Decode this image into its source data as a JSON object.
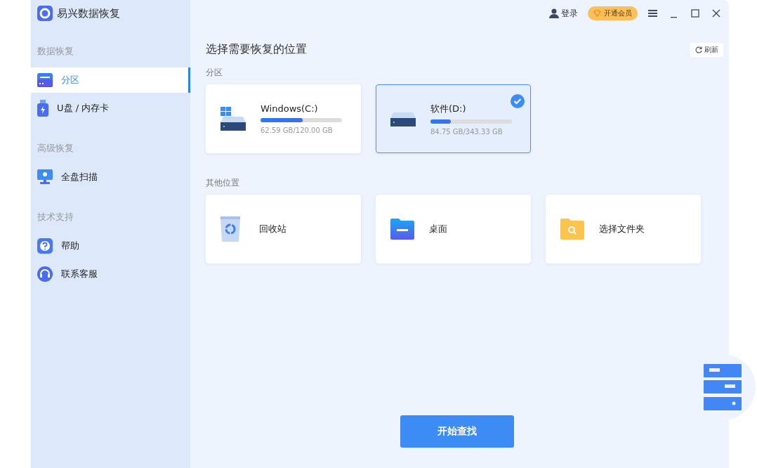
{
  "app": {
    "title": "易兴数据恢复"
  },
  "sidebar": [
    {
      "heading": "数据恢复",
      "items": [
        {
          "label": "分区",
          "kind": "drive",
          "selected": true
        },
        {
          "label": "U盘 / 内存卡",
          "kind": "usb",
          "selected": false
        }
      ]
    },
    {
      "heading": "高级恢复",
      "items": [
        {
          "label": "全盘扫描",
          "kind": "scan",
          "selected": false
        }
      ]
    },
    {
      "heading": "技术支持",
      "items": [
        {
          "label": "帮助",
          "kind": "help",
          "selected": false
        },
        {
          "label": "联系客服",
          "kind": "support",
          "selected": false
        }
      ]
    }
  ],
  "header": {
    "login": "登录",
    "vip": "开通会员"
  },
  "title": "选择需要恢复的位置",
  "refresh": "刷新",
  "partitions_label": "分区",
  "partitions": [
    {
      "name": "Windows(C:)",
      "kind": "system",
      "usage": "62.59 GB/120.00 GB",
      "level": 0.52,
      "selected": false
    },
    {
      "name": "软件(D:)",
      "kind": "data",
      "usage": "84.75 GB/343.33 GB",
      "level": 0.25,
      "selected": true
    }
  ],
  "other_label": "其他位置",
  "other": [
    {
      "label": "回收站",
      "kind": "recycle"
    },
    {
      "label": "桌面",
      "kind": "desktop"
    },
    {
      "label": "选择文件夹",
      "kind": "folder"
    }
  ],
  "start": "开始查找"
}
